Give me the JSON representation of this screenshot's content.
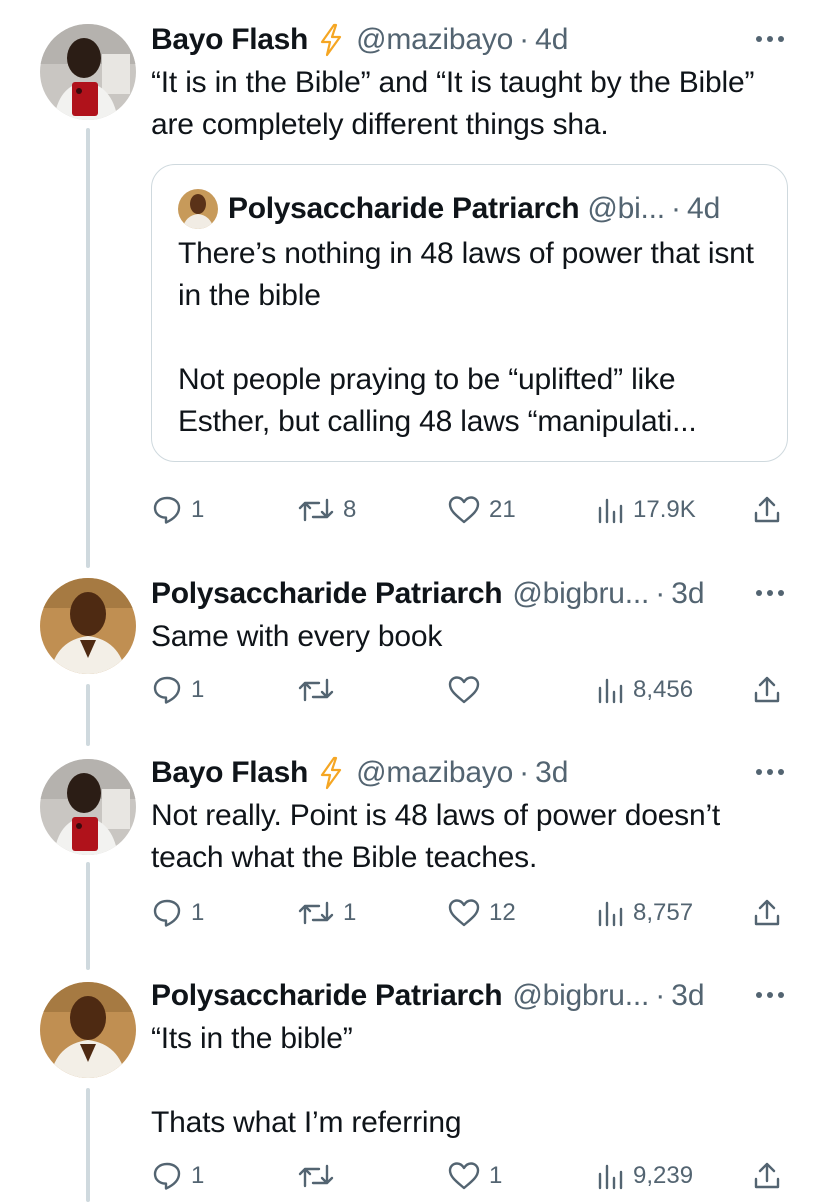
{
  "colors": {
    "text": "#0f1419",
    "secondary": "#536471",
    "thread_line": "#cfd9de",
    "bolt": "#f5a623"
  },
  "tweets": [
    {
      "name": "Bayo Flash",
      "verified_icon": "lightning-bolt-icon",
      "handle": "@mazibayo",
      "dot": "·",
      "time": "4d",
      "text": "“It is in the Bible” and “It is taught by the Bible” are completely different things sha.",
      "quote": {
        "name": "Polysaccharide Patriarch",
        "handle": "@bi...",
        "dot": "·",
        "time": "4d",
        "text": "There’s nothing in 48 laws of power that isnt in the bible\n\nNot people praying to be “uplifted” like Esther, but calling 48 laws “manipulati..."
      },
      "actions": {
        "replies": "1",
        "retweets": "8",
        "likes": "21",
        "views": "17.9K"
      }
    },
    {
      "name": "Polysaccharide Patriarch",
      "handle": "@bigbru...",
      "dot": "·",
      "time": "3d",
      "text": "Same with every book",
      "actions": {
        "replies": "1",
        "retweets": "",
        "likes": "",
        "views": "8,456"
      }
    },
    {
      "name": "Bayo Flash",
      "verified_icon": "lightning-bolt-icon",
      "handle": "@mazibayo",
      "dot": "·",
      "time": "3d",
      "text": "Not really. Point is 48 laws of power doesn’t teach what the Bible teaches.",
      "actions": {
        "replies": "1",
        "retweets": "1",
        "likes": "12",
        "views": "8,757"
      }
    },
    {
      "name": "Polysaccharide Patriarch",
      "handle": "@bigbru...",
      "dot": "·",
      "time": "3d",
      "text": "“Its in the bible”\n\nThats what I’m referring",
      "actions": {
        "replies": "1",
        "retweets": "",
        "likes": "1",
        "views": "9,239"
      }
    }
  ]
}
